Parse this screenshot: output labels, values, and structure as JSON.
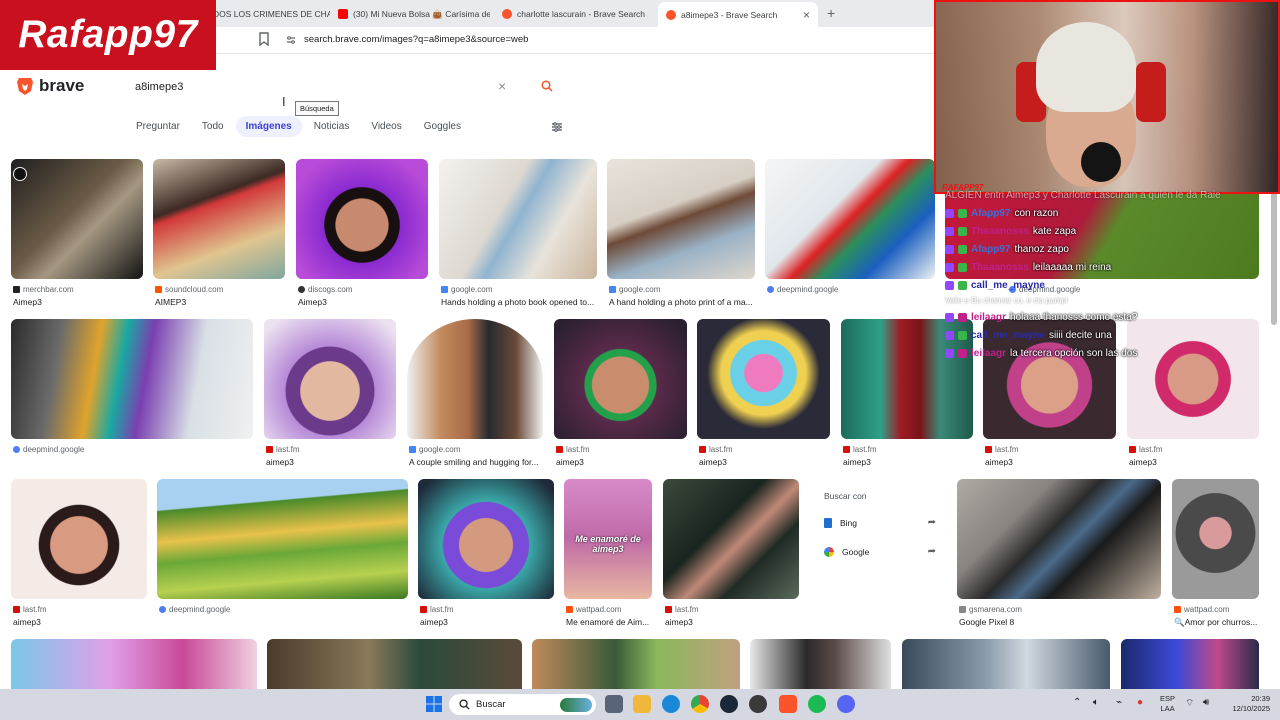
{
  "tabs": [
    {
      "label": "DOS LOS CRIMENES DE CHA",
      "color": "#c8101e"
    },
    {
      "label": "(30) Mi Nueva Bolsa 👜 Carísima de",
      "color": "#ff0000"
    },
    {
      "label": "charlotte lascurain - Brave Search",
      "color": "#fb542b"
    },
    {
      "label": "a8imepe3 - Brave Search",
      "color": "#fb542b",
      "active": true
    }
  ],
  "url": "search.brave.com/images?q=a8imepe3&source=web",
  "overlay_logo": "Rafapp97",
  "brand": {
    "name": "brave",
    "color": "#fb542b"
  },
  "search": {
    "query": "a8imepe3",
    "tooltip": "Búsqueda"
  },
  "nav": [
    "Preguntar",
    "Todo",
    "Imágenes",
    "Noticias",
    "Videos",
    "Goggles"
  ],
  "results": [
    {
      "source": "merchbar.com",
      "title": "Aimep3",
      "icon": "#222"
    },
    {
      "source": "soundcloud.com",
      "title": "AIMEP3",
      "icon": "#ff5500"
    },
    {
      "source": "discogs.com",
      "title": "Aimep3",
      "icon": "#333"
    },
    {
      "source": "google.com",
      "title": "Hands holding a photo book opened to...",
      "icon": "#4285f4"
    },
    {
      "source": "google.com",
      "title": "A hand holding a photo print of a ma...",
      "icon": "#4285f4"
    },
    {
      "source": "deepmind.google",
      "title": "",
      "icon": "#4f7df3"
    },
    {
      "source": "deepmind.google",
      "title": "",
      "icon": "#4f7df3"
    },
    {
      "source": "last.fm",
      "title": "aimep3",
      "icon": "#d51007"
    },
    {
      "source": "google.com",
      "title": "A couple smiling and hugging for...",
      "icon": "#4285f4"
    },
    {
      "source": "last.fm",
      "title": "aimep3",
      "icon": "#d51007"
    },
    {
      "source": "last.fm",
      "title": "aimep3",
      "icon": "#d51007"
    },
    {
      "source": "last.fm",
      "title": "aimep3",
      "icon": "#d51007"
    },
    {
      "source": "last.fm",
      "title": "aimep3",
      "icon": "#d51007"
    },
    {
      "source": "last.fm",
      "title": "aimep3",
      "icon": "#d51007"
    },
    {
      "source": "last.fm",
      "title": "aimep3",
      "icon": "#d51007"
    },
    {
      "source": "deepmind.google",
      "title": "",
      "icon": "#4f7df3"
    },
    {
      "source": "last.fm",
      "title": "aimep3",
      "icon": "#d51007"
    },
    {
      "source": "wattpad.com",
      "title": "Me enamoré de Aim...",
      "icon": "#ff500a"
    },
    {
      "source": "last.fm",
      "title": "aimep3",
      "icon": "#d51007"
    },
    {
      "source": "gsmarena.com",
      "title": "Google Pixel 8",
      "icon": "#888"
    },
    {
      "source": "wattpad.com",
      "title": "🔍Amor por churros...",
      "icon": "#ff500a"
    }
  ],
  "search_with": {
    "heading": "Buscar con",
    "engines": [
      "Bing",
      "Google"
    ]
  },
  "thumb_text": "Me enamoré de aimep3",
  "stream": {
    "tag": "RAFAPP97"
  },
  "chat": [
    {
      "user": "",
      "msg": "ALGIEN entri Aimep3 y Charlotte Lascurain a quien le da Raie",
      "color": "#ffffff",
      "ghost": true
    },
    {
      "user": "Afapp97",
      "msg": "con razon",
      "color": "#3b6fd8"
    },
    {
      "user": "Thaaanosss",
      "msg": "kate zapa",
      "color": "#c0208a"
    },
    {
      "user": "Afapp97",
      "msg": "thanoz zapo",
      "color": "#3b6fd8"
    },
    {
      "user": "Thaaanosss",
      "msg": "leilaaaaa mi reina",
      "color": "#c0208a"
    },
    {
      "user": "call_me_mayne",
      "msg": "",
      "color": "#2a2aa8"
    },
    {
      "user": "",
      "msg": "Valie e Bu chanvar co, e clu pumpl",
      "color": "#ffffff",
      "ghost": true
    },
    {
      "user": "leilaagr",
      "msg": "holaaa thanosss como esta?",
      "color": "#c0208a"
    },
    {
      "user": "call_me_mayne",
      "msg": "siiii decite una",
      "color": "#2a2aa8"
    },
    {
      "user": "leilaagr",
      "msg": "la tercera opción son las dos",
      "color": "#c0208a"
    }
  ],
  "taskbar": {
    "search_label": "Buscar",
    "lang": "ESP",
    "lang2": "LAA",
    "time": "20:39",
    "date": "12/10/2025"
  }
}
